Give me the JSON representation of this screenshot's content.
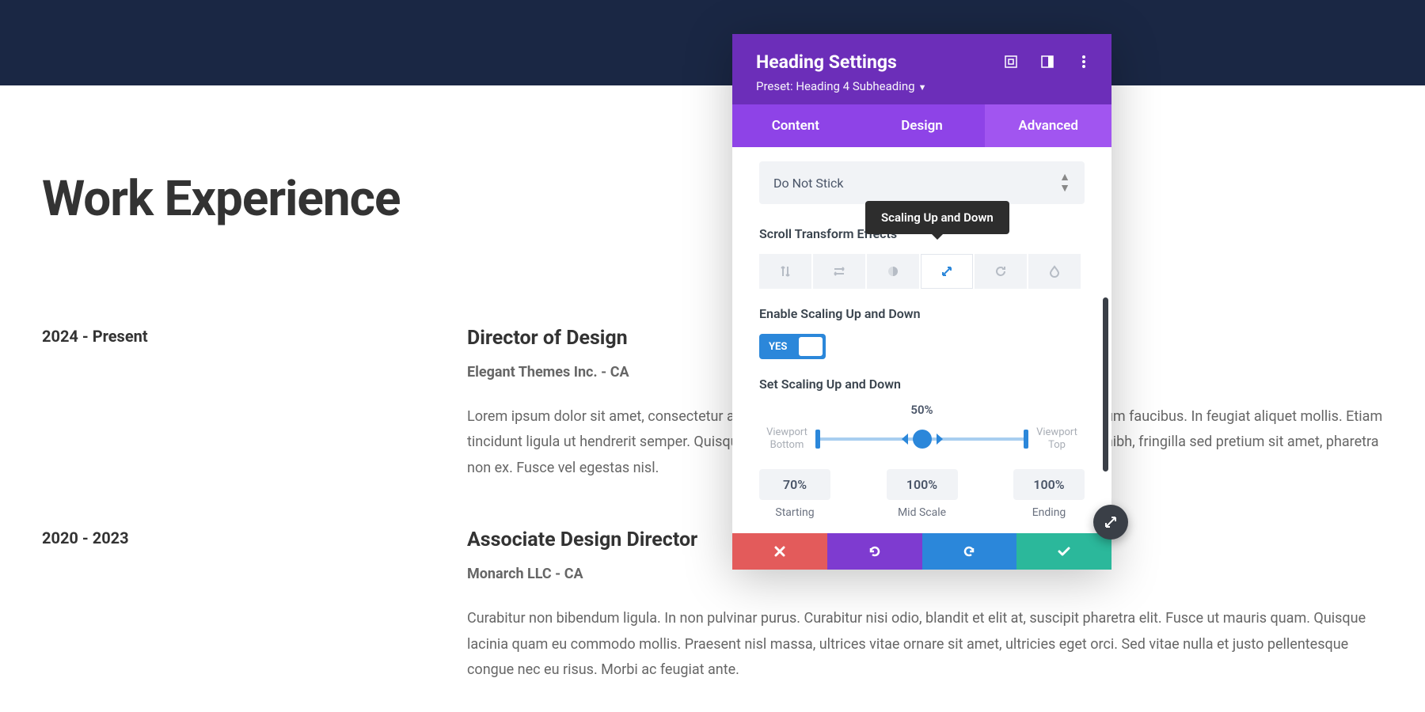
{
  "page": {
    "section_title": "Work Experience",
    "jobs": [
      {
        "dates": "2024 - Present",
        "title": "Director of Design",
        "company": "Elegant Themes Inc. - CA",
        "desc": "Lorem ipsum dolor sit amet, consectetur adipiscing elit. Pellentesque aliquet velit sit amet sem interdum faucibus. In feugiat aliquet mollis. Etiam tincidunt ligula ut hendrerit semper. Quisque luctus lectus non turpis bibendum posuere. Morbi tortor nibh, fringilla sed pretium sit amet, pharetra non ex. Fusce vel egestas nisl."
      },
      {
        "dates": "2020 - 2023",
        "title": "Associate Design Director",
        "company": "Monarch LLC - CA",
        "desc": "Curabitur non bibendum ligula. In non pulvinar purus. Curabitur nisi odio, blandit et elit at, suscipit pharetra elit. Fusce ut mauris quam. Quisque lacinia quam eu commodo mollis. Praesent nisl massa, ultrices vitae ornare sit amet, ultricies eget orci. Sed vitae nulla et justo pellentesque congue nec eu risus. Morbi ac feugiat ante."
      }
    ]
  },
  "panel": {
    "title": "Heading Settings",
    "preset": "Preset: Heading 4 Subheading",
    "tabs": {
      "content": "Content",
      "design": "Design",
      "advanced": "Advanced"
    },
    "sticky_select": "Do Not Stick",
    "scroll_label": "Scroll Transform Effects",
    "tooltip": "Scaling Up and Down",
    "enable_label": "Enable Scaling Up and Down",
    "toggle_value": "YES",
    "set_label": "Set Scaling Up and Down",
    "mid_percent": "50%",
    "viewport_bottom": "Viewport Bottom",
    "viewport_top": "Viewport Top",
    "values": {
      "starting": "70%",
      "mid": "100%",
      "ending": "100%"
    },
    "labels": {
      "starting": "Starting",
      "mid": "Mid Scale",
      "ending": "Ending"
    }
  }
}
